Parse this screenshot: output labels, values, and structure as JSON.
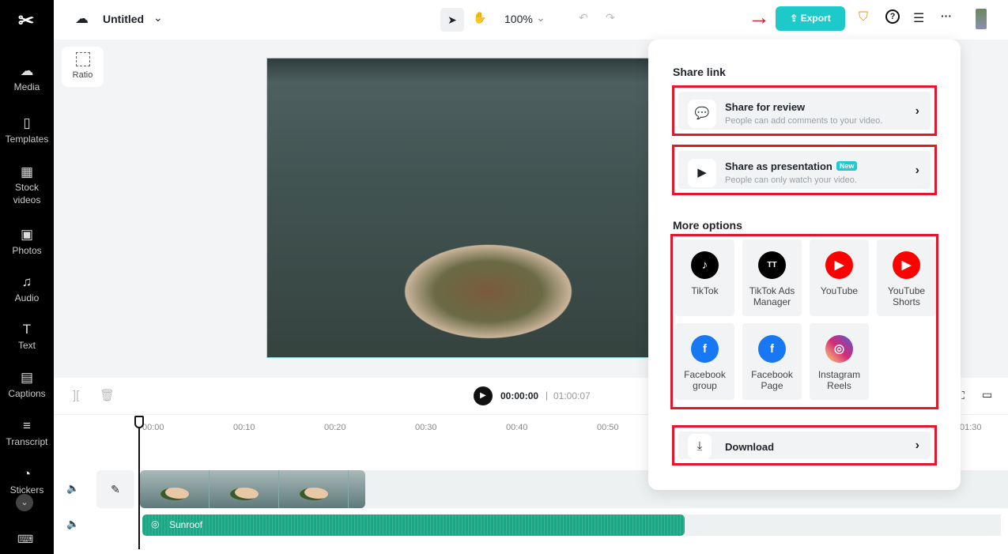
{
  "app": {
    "title": "Untitled",
    "zoom": "100%"
  },
  "sidebar": {
    "items": [
      {
        "label": "Media",
        "icon": "cloud-upload-icon"
      },
      {
        "label": "Templates",
        "icon": "templates-icon"
      },
      {
        "label": "Stock videos",
        "icon": "film-icon"
      },
      {
        "label": "Photos",
        "icon": "image-icon"
      },
      {
        "label": "Audio",
        "icon": "music-icon"
      },
      {
        "label": "Text",
        "icon": "text-icon"
      },
      {
        "label": "Captions",
        "icon": "captions-icon"
      },
      {
        "label": "Transcript",
        "icon": "transcript-icon"
      },
      {
        "label": "Stickers",
        "icon": "sticker-icon"
      }
    ]
  },
  "toolbar": {
    "export_label": "Export",
    "accent": "#1ec9c9"
  },
  "canvas": {
    "ratio_label": "Ratio"
  },
  "timeline": {
    "current_time": "00:00:00",
    "separator": "|",
    "total_time": "01:00:07",
    "ticks": [
      "00:00",
      "00:10",
      "00:20",
      "00:30",
      "00:40",
      "00:50",
      "01:30"
    ],
    "audio_clip": "Sunroof"
  },
  "popup": {
    "share_link_title": "Share link",
    "share_review": {
      "title": "Share for review",
      "subtitle": "People can add comments to your video."
    },
    "share_presentation": {
      "title": "Share as presentation",
      "badge": "New",
      "subtitle": "People can only watch your video."
    },
    "more_options_title": "More options",
    "platforms": [
      {
        "label": "TikTok",
        "color": "#000000"
      },
      {
        "label": "TikTok Ads Manager",
        "color": "#000000"
      },
      {
        "label": "YouTube",
        "color": "#ff0000"
      },
      {
        "label": "YouTube Shorts",
        "color": "#ff0000"
      },
      {
        "label": "Facebook group",
        "color": "#1877f2"
      },
      {
        "label": "Facebook Page",
        "color": "#1877f2"
      },
      {
        "label": "Instagram Reels",
        "color": "#d62976"
      }
    ],
    "download_label": "Download"
  },
  "annotation_color": "#e0182b"
}
